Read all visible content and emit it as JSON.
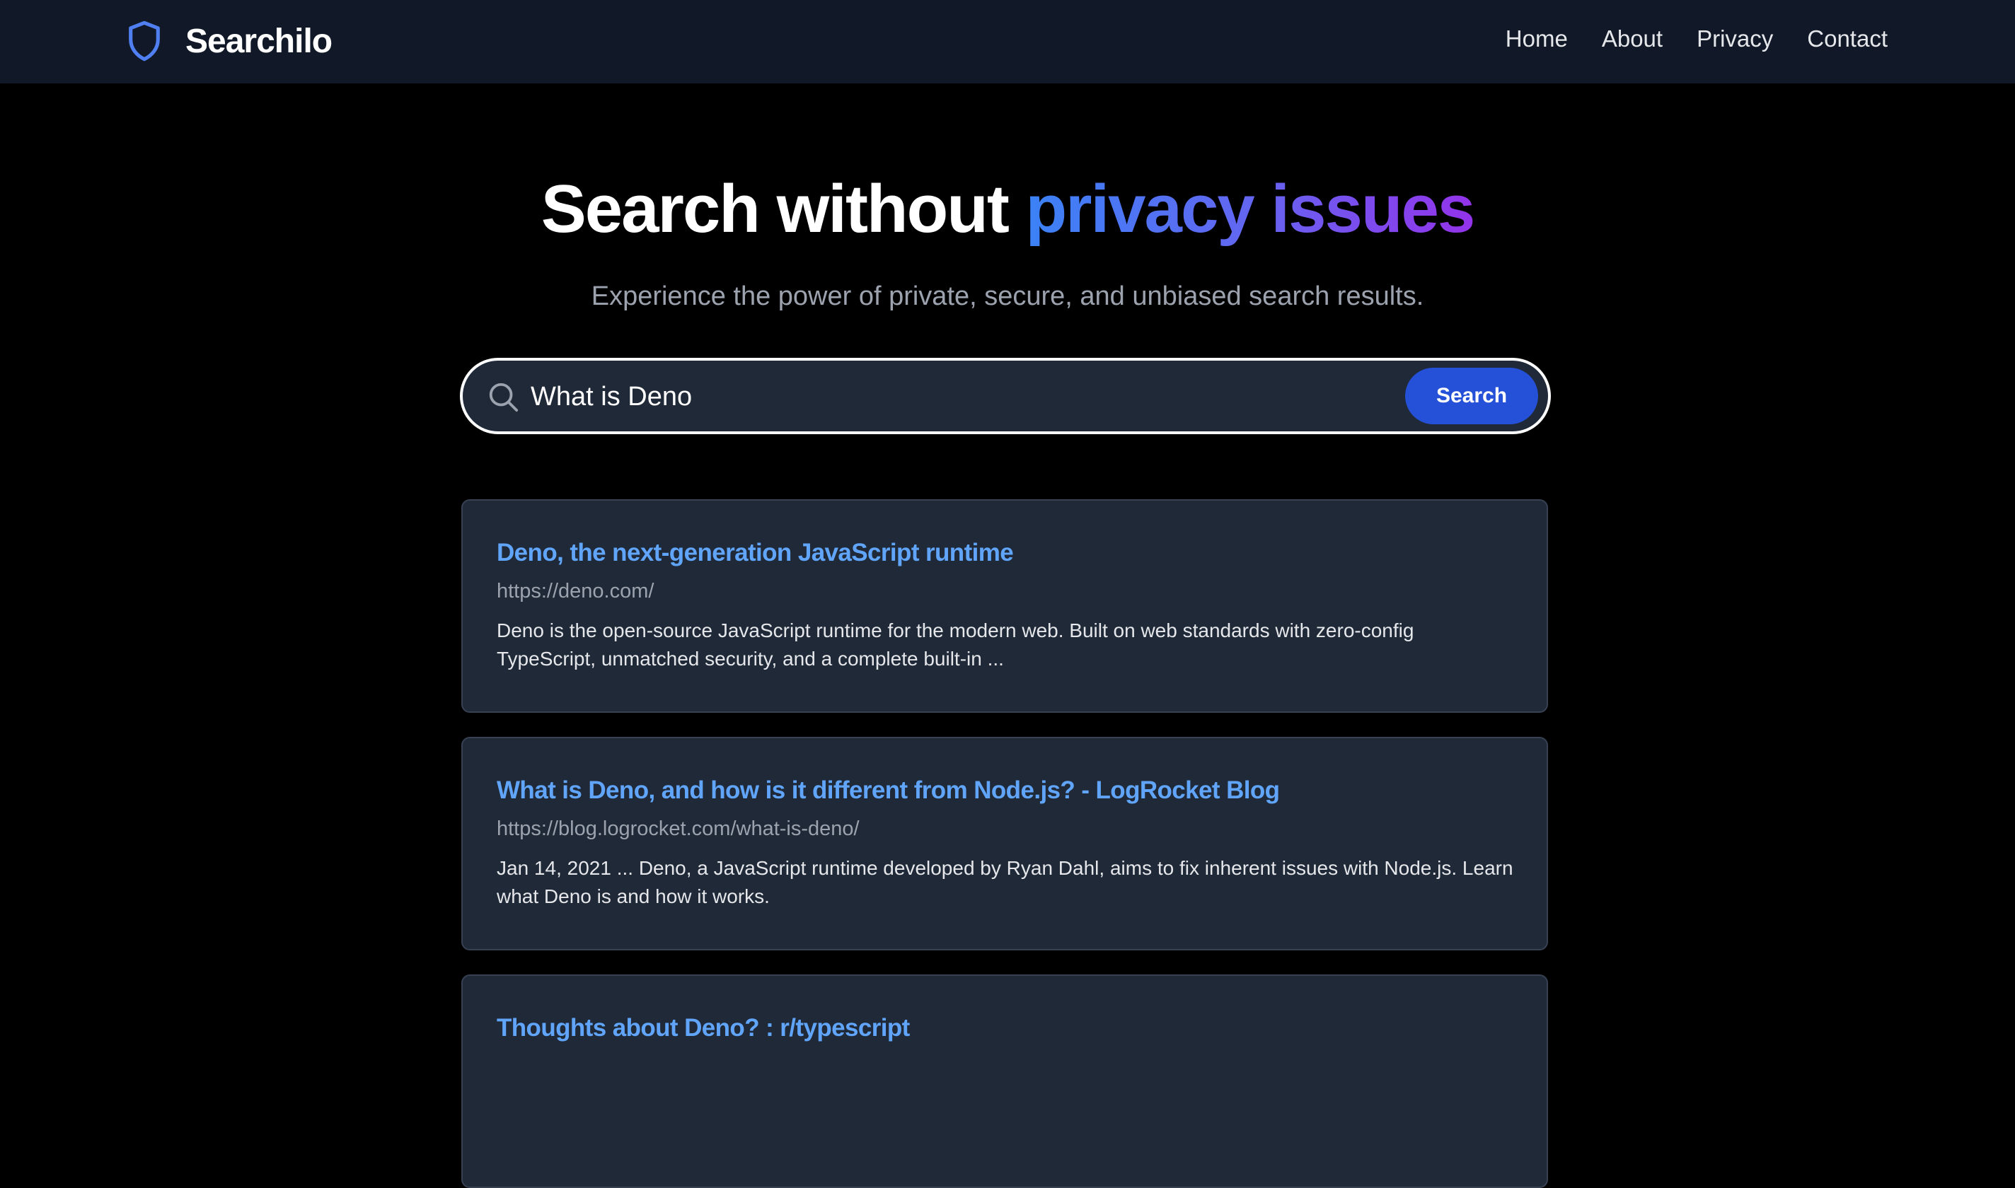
{
  "header": {
    "brand_name": "Searchilo",
    "brand_icon": "shield-icon",
    "nav": [
      {
        "label": "Home"
      },
      {
        "label": "About"
      },
      {
        "label": "Privacy"
      },
      {
        "label": "Contact"
      }
    ]
  },
  "hero": {
    "title_plain": "Search without ",
    "title_highlight": "privacy issues",
    "subtitle": "Experience the power of private, secure, and unbiased search results."
  },
  "search": {
    "value": "What is Deno",
    "placeholder": "",
    "icon": "search-icon",
    "button_label": "Search"
  },
  "results": [
    {
      "title": "Deno, the next-generation JavaScript runtime",
      "url": "https://deno.com/",
      "snippet": "Deno is the open-source JavaScript runtime for the modern web. Built on web standards with zero-config TypeScript, unmatched security, and a complete built-in ..."
    },
    {
      "title": "What is Deno, and how is it different from Node.js? - LogRocket Blog",
      "url": "https://blog.logrocket.com/what-is-deno/",
      "snippet": "Jan 14, 2021 ... Deno, a JavaScript runtime developed by Ryan Dahl, aims to fix inherent issues with Node.js. Learn what Deno is and how it works."
    },
    {
      "title": "Thoughts about Deno? : r/typescript",
      "url": "",
      "snippet": ""
    }
  ],
  "colors": {
    "page_background": "#000000",
    "navbar_background": "#111827",
    "card_background": "#1f2937",
    "link_blue": "#60a5fa",
    "button_blue": "#2550d8",
    "gradient_start": "#3b82f6",
    "gradient_end": "#9333ea"
  }
}
